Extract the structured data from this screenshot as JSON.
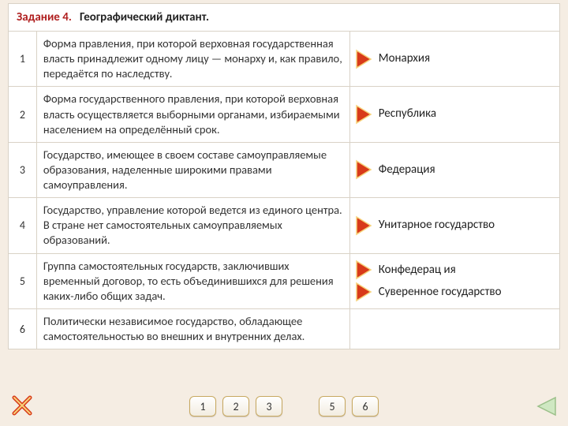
{
  "header": {
    "task_no": "Задание 4.",
    "task_title": "Географический диктант."
  },
  "rows": [
    {
      "n": "1",
      "desc": "Форма правления, при которой верховная государственная власть принадлежит одному лицу — монарху и, как правило, передаётся по наследству.",
      "answers": [
        "Монархия"
      ]
    },
    {
      "n": "2",
      "desc": "Форма государственного правления, при которой верховная власть осуществляется выборными органами, избираемыми населением на определённый срок.",
      "answers": [
        "Республика"
      ]
    },
    {
      "n": "3",
      "desc": "Государство, имеющее в своем составе самоуправляемые образования, наделенные широкими правами самоуправления.",
      "answers": [
        "Федерация"
      ]
    },
    {
      "n": "4",
      "desc": "Государство, управление которой ведется из единого центра. В стране нет самостоятельных самоуправляемых образований.",
      "answers": [
        "Унитарное государство"
      ]
    },
    {
      "n": "5",
      "desc": "Группа самостоятельных государств, заключивших временный договор, то есть объединившихся для решения каких-либо общих задач.",
      "answers": [
        "Конфедерац ия"
      ]
    },
    {
      "n": "6",
      "desc": "Политически независимое государство, обладающее самостоятельностью во внешних и внутренних делах.",
      "answers": [
        "Суверенное государство"
      ]
    }
  ],
  "row5_extra_answer": "Суверенное государство",
  "nav": [
    "1",
    "2",
    "3",
    "5",
    "6"
  ],
  "colors": {
    "arrow_fill": "#d83a1a",
    "arrow_stroke": "#f7d27a"
  }
}
